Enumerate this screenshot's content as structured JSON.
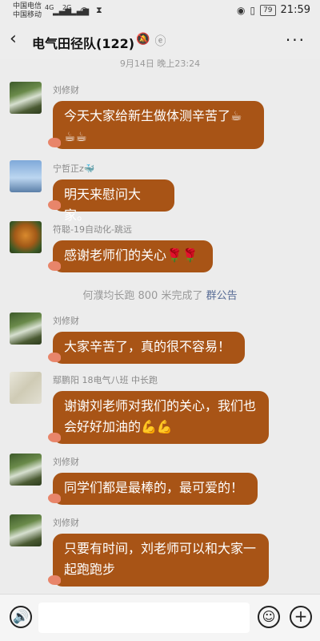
{
  "status": {
    "carrier1": "中国电信",
    "carrier2": "中国移动",
    "net1": "4G",
    "net2": "2G",
    "battery": "79",
    "time": "21:59"
  },
  "nav": {
    "back": "‹",
    "title": "电气田径队(122)",
    "more": "···"
  },
  "timestamp": "9月14日 晚上23:24",
  "notice": {
    "text": "何濮均长跑 800 米完成了 ",
    "link": "群公告"
  },
  "messages": [
    {
      "sender": "刘修财",
      "text": "今天大家给新生做体测辛苦了☕ ☕☕"
    },
    {
      "sender": "宁哲正z🐳",
      "text": "明天来慰问大家。"
    },
    {
      "sender": "符聪-19自动化-跳远",
      "text": "感谢老师们的关心🌹🌹"
    },
    {
      "sender": "刘修财",
      "text": "大家辛苦了，真的很不容易！"
    },
    {
      "sender": "鄢鹏阳 18电气八班 中长跑",
      "text": "谢谢刘老师对我们的关心，我们也会好好加油的💪💪"
    },
    {
      "sender": "刘修财",
      "text": "同学们都是最棒的，最可爱的！"
    },
    {
      "sender": "刘修财",
      "text": "只要有时间，刘老师可以和大家一起跑跑步"
    }
  ],
  "input": {
    "voice": "🔊",
    "emoji": "☺",
    "plus": "+"
  },
  "colors": {
    "bubble": "#a85416",
    "background": "#ececec",
    "link": "#576b95"
  }
}
